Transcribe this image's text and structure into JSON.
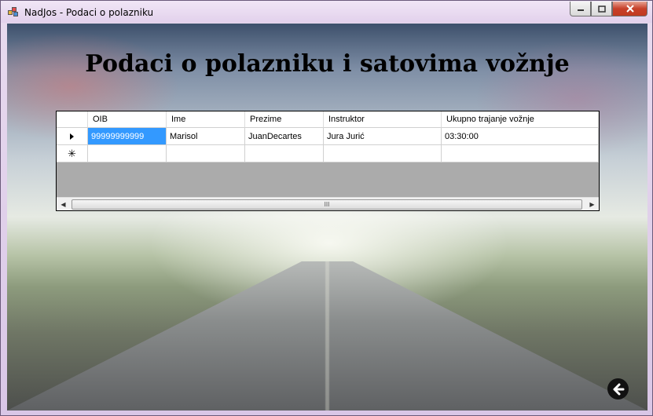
{
  "window": {
    "title": "NadJos - Podaci o polazniku",
    "minimize_glyph": "▭",
    "maximize_glyph": "☐",
    "close_glyph": "✕"
  },
  "heading": "Podaci o polazniku i satovima vožnje",
  "grid": {
    "columns": [
      "OIB",
      "Ime",
      "Prezime",
      "Instruktor",
      "Ukupno trajanje vožnje"
    ],
    "rows": [
      {
        "indicator": "current-row",
        "cells": [
          "99999999999",
          "Marisol",
          "JuanDecartes",
          "Jura Jurić",
          "03:30:00"
        ]
      }
    ],
    "new_row_indicator": "✳",
    "scroll_left_glyph": "◀",
    "scroll_right_glyph": "▶",
    "scroll_thumb_grip": "III"
  },
  "back_button": {
    "icon": "arrow-left-icon",
    "glyph": "🡸"
  },
  "colors": {
    "selection": "#3399ff",
    "grid_background": "#ababab"
  }
}
